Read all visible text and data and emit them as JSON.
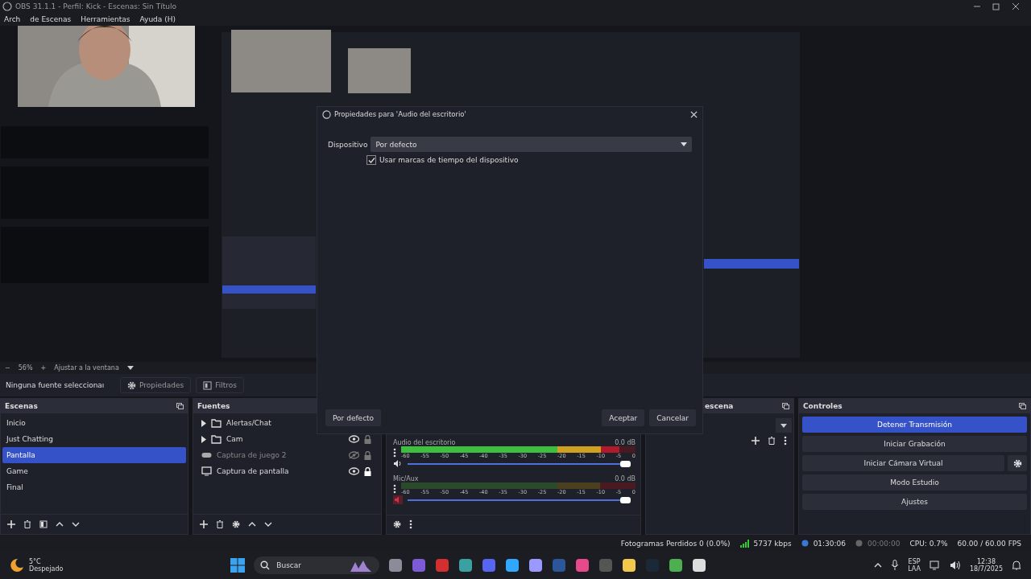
{
  "window": {
    "title": "OBS 31.1.1 - Perfil: Kick - Escenas: Sin Título"
  },
  "menu": [
    "Arch",
    "de Escenas",
    "Herramientas",
    "Ayuda (H)"
  ],
  "zoom_bar": {
    "minus": "−",
    "zoom": "56%",
    "plus": "+",
    "fit": "Ajustar a la ventana"
  },
  "source_toolbar": {
    "label": "Ninguna fuente seleccionaı",
    "buttons": [
      {
        "kind": "gear",
        "label": "Propiedades"
      },
      {
        "kind": "filter",
        "label": "Filtros"
      }
    ]
  },
  "scenes": {
    "title": "Escenas",
    "items": [
      {
        "label": "Inicio",
        "selected": false
      },
      {
        "label": "Just Chatting",
        "selected": false
      },
      {
        "label": "Pantalla",
        "selected": true
      },
      {
        "label": "Game",
        "selected": false
      },
      {
        "label": "Final",
        "selected": false
      }
    ]
  },
  "sources": {
    "title": "Fuentes",
    "items": [
      {
        "kind": "group",
        "label": "Alertas/Chat"
      },
      {
        "kind": "group",
        "label": "Cam",
        "visible": true,
        "locked": false
      },
      {
        "kind": "game",
        "label": "Captura de juego 2",
        "visible": false,
        "locked": false
      },
      {
        "kind": "display",
        "label": "Captura de pantalla",
        "visible": true,
        "locked": true
      }
    ]
  },
  "mixer": {
    "channels": [
      {
        "name": "Audio del escritorio",
        "reading": "0.0 dB",
        "muted": false,
        "meter": {
          "level": 0.93
        },
        "ticks": [
          "-60",
          "-55",
          "-50",
          "-45",
          "-40",
          "-35",
          "-30",
          "-25",
          "-20",
          "-15",
          "-10",
          "-5",
          "0"
        ],
        "volume": {
          "level": 1
        }
      },
      {
        "name": "Mic/Aux",
        "reading": "0.0 dB",
        "muted": true,
        "ticks": [
          "-60",
          "-55",
          "-50",
          "-45",
          "-40",
          "-35",
          "-30",
          "-25",
          "-20",
          "-15",
          "-10",
          "-5",
          "0"
        ],
        "volume": {
          "level": 1
        }
      }
    ]
  },
  "transitions": {
    "title": "escena"
  },
  "controls": {
    "title": "Controles",
    "buttons": [
      {
        "label": "Detener Transmisión",
        "active": true,
        "gear": false
      },
      {
        "label": "Iniciar Grabación",
        "active": false,
        "gear": false
      },
      {
        "label": "Iniciar Cámara Virtual",
        "active": false,
        "gear": true
      },
      {
        "label": "Modo Estudio",
        "active": false,
        "gear": false
      },
      {
        "label": "Ajustes",
        "active": false,
        "gear": false
      }
    ]
  },
  "status_bar": {
    "dropped": "Fotogramas Perdidos 0 (0.0%)",
    "bitrate": "5737 kbps",
    "stream_time": "01:30:06",
    "record_time": "00:00:00",
    "cpu": "CPU: 0.7%",
    "fps": "60.00 / 60.00 FPS"
  },
  "dialog": {
    "title": "Propiedades para 'Audio del escritorio'",
    "device_label": "Dispositivo",
    "device_value": "Por defecto",
    "timestamps": {
      "label": "Usar marcas de tiempo del dispositivo",
      "checked": true
    },
    "defaults_button": "Por defecto",
    "ok_button": "Aceptar",
    "cancel_button": "Cancelar"
  },
  "taskbar": {
    "weather": {
      "temp": "5°C",
      "desc": "Despejado"
    },
    "search": "Buscar",
    "tray": {
      "lang": "ESP",
      "layout": "LAA",
      "time": "12:38",
      "date": "18/7/2025"
    }
  }
}
